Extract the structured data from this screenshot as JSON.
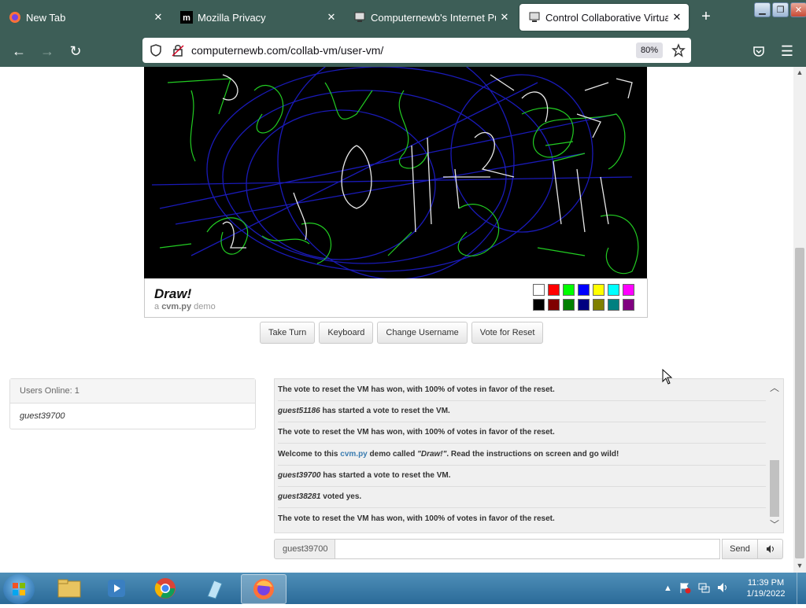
{
  "browser": {
    "tabs": [
      {
        "title": "New Tab",
        "icon": "firefox-icon",
        "active": false
      },
      {
        "title": "Mozilla Privacy",
        "icon": "mozilla-icon",
        "active": false
      },
      {
        "title": "Computernewb's Internet Pub",
        "icon": "computernewb-icon",
        "active": false
      },
      {
        "title": "Control Collaborative Virtual M",
        "icon": "computernewb-icon",
        "active": true
      }
    ],
    "new_tab_symbol": "+",
    "url": "computernewb.com/collab-vm/user-vm/",
    "zoom": "80%"
  },
  "vm": {
    "title": "Draw!",
    "subtitle_prefix": "a",
    "subtitle_name": "cvm.py",
    "subtitle_suffix": "demo",
    "palette": [
      "#ffffff",
      "#ff0000",
      "#00ff00",
      "#0000ff",
      "#ffff00",
      "#00ffff",
      "#ff00ff",
      "#000000",
      "#800000",
      "#008000",
      "#000080",
      "#808000",
      "#008080",
      "#800080"
    ],
    "buttons": [
      "Take Turn",
      "Keyboard",
      "Change Username",
      "Vote for Reset"
    ]
  },
  "users": {
    "header": "Users Online: 1",
    "list": [
      "guest39700"
    ]
  },
  "chat": {
    "messages": [
      {
        "user": "",
        "text": "The vote to reset the VM has won, with 100% of votes in favor of the reset."
      },
      {
        "user": "guest51186",
        "text": " has started a vote to reset the VM."
      },
      {
        "user": "",
        "text": "The vote to reset the VM has won, with 100% of votes in favor of the reset."
      },
      {
        "user": "",
        "text": "",
        "welcome": true
      },
      {
        "user": "guest39700",
        "text": " has started a vote to reset the VM."
      },
      {
        "user": "guest38281",
        "text": " voted yes."
      },
      {
        "user": "",
        "text": "The vote to reset the VM has won, with 100% of votes in favor of the reset."
      }
    ],
    "welcome": {
      "pre": "Welcome to this ",
      "link": "cvm.py",
      "mid": " demo called ",
      "name": "\"Draw!\"",
      "post": ". Read the instructions on screen and go wild!"
    },
    "username": "guest39700",
    "input_value": "",
    "send_label": "Send",
    "volume_icon": "speaker-icon"
  },
  "taskbar": {
    "time": "11:39 PM",
    "date": "1/19/2022"
  },
  "colors": {
    "chrome": "#3d5e57",
    "taskbar": "#2a6a98",
    "link": "#3b7cb0"
  }
}
